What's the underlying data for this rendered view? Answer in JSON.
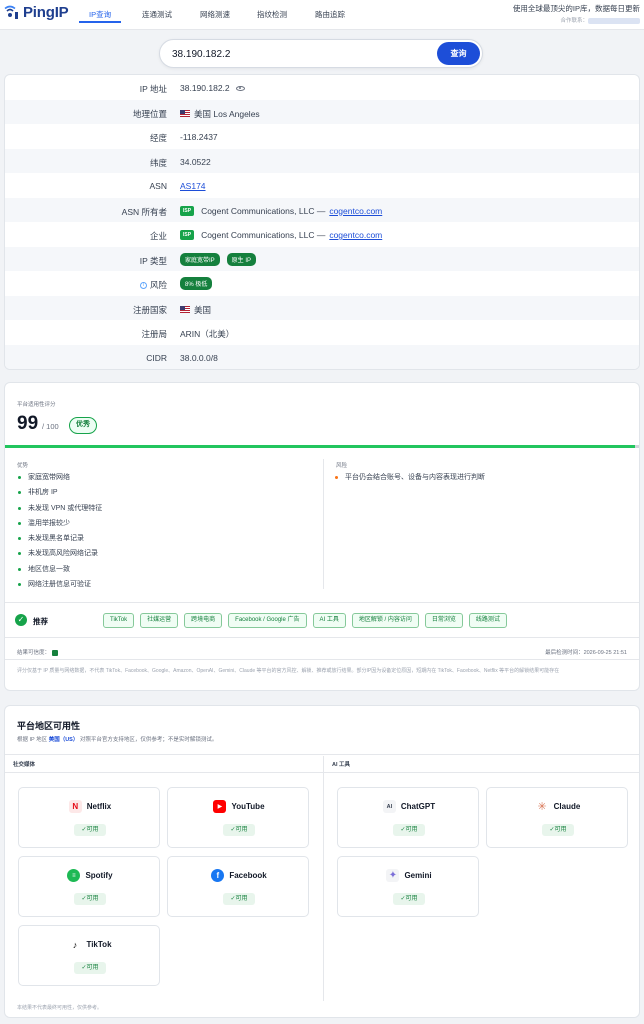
{
  "app": {
    "logo_text": "PingIP",
    "tagline": "使用全球最顶尖的IP库，数据每日更新",
    "partner_label": "合作联系："
  },
  "nav": {
    "items": [
      {
        "label": "IP查询",
        "active": true
      },
      {
        "label": "连通测试",
        "active": false
      },
      {
        "label": "网络测速",
        "active": false
      },
      {
        "label": "指纹检测",
        "active": false
      },
      {
        "label": "路由追踪",
        "active": false
      }
    ]
  },
  "search": {
    "value": "38.190.182.2",
    "button_label": "查询"
  },
  "ip_info": {
    "rows": [
      {
        "label": "IP 地址",
        "value": "38.190.182.2"
      },
      {
        "label": "地理位置",
        "value": "美国 Los Angeles"
      },
      {
        "label": "经度",
        "value": "-118.2437"
      },
      {
        "label": "纬度",
        "value": "34.0522"
      },
      {
        "label": "ASN",
        "value": "AS174"
      },
      {
        "label": "ASN 所有者",
        "value": "Cogent Communications, LLC —",
        "link": "cogentco.com",
        "badge": "ISP"
      },
      {
        "label": "企业",
        "value": "Cogent Communications, LLC —",
        "link": "cogentco.com",
        "badge": "ISP"
      },
      {
        "label": "IP 类型",
        "tags": [
          "家庭宽带IP",
          "原生 IP"
        ]
      },
      {
        "label": "风险",
        "tag": "8% 极低"
      },
      {
        "label": "注册国家",
        "value": "美国"
      },
      {
        "label": "注册局",
        "value": "ARIN（北美）"
      },
      {
        "label": "CIDR",
        "value": "38.0.0.0/8"
      }
    ]
  },
  "score": {
    "label": "平台适用性评分",
    "value": "99",
    "max": "/ 100",
    "grade": "优秀",
    "fill": 0.99,
    "advantages_label": "优势",
    "advantages": [
      "家庭宽带网络",
      "非机房 IP",
      "未发现 VPN 或代理特征",
      "滥用举报较少",
      "未发现黑名单记录",
      "未发现高风险网络记录",
      "地区信息一致",
      "网络注册信息可验证"
    ],
    "risks_label": "风险",
    "risks": [
      "平台仍会结合账号、设备与内容表现进行判断"
    ],
    "recommend_label": "推荐",
    "recommend_chips": [
      "TikTok",
      "社媒运营",
      "跨境电商",
      "Facebook / Google 广告",
      "AI 工具",
      "地区解锁 / 内容访问",
      "日常浏览",
      "线路测试"
    ],
    "accuracy_label": "结果可信度：",
    "detect_time": "最后检测时间：2026-09-25 21:51",
    "disclaimer": "评分仅基于 IP 质量与网络数据，不代表 TikTok、Facebook、Google、Amazon、OpenAI、Gemini、Claude 等平台的官方风控、解锁、推荐或放行结果。部分IP因为设备定位原因，短期内在 TikTok、Facebook、Netflix 等平台的解锁结果可能存在"
  },
  "platforms": {
    "title": "平台地区可用性",
    "subtitle_prefix": "根据 IP 地区",
    "subtitle_region": "美国（US）",
    "subtitle_suffix": "对照平台官方支持地区，仅供参考；不是实时解锁测试。",
    "social_label": "社交媒体",
    "ai_label": "AI 工具",
    "social": [
      {
        "name": "Netflix",
        "status": "✓可用",
        "icon": "netflix-icon",
        "color": "#e50914"
      },
      {
        "name": "YouTube",
        "status": "✓可用",
        "icon": "youtube-icon",
        "color": "#ff0000"
      },
      {
        "name": "Spotify",
        "status": "✓可用",
        "icon": "spotify-icon",
        "color": "#1db954"
      },
      {
        "name": "Facebook",
        "status": "✓可用",
        "icon": "facebook-icon",
        "color": "#1877f2"
      },
      {
        "name": "TikTok",
        "status": "✓可用",
        "icon": "tiktok-icon",
        "color": "#000000"
      }
    ],
    "ai": [
      {
        "name": "ChatGPT",
        "status": "✓可用",
        "icon": "chatgpt-icon",
        "color": "#374151"
      },
      {
        "name": "Claude",
        "status": "✓可用",
        "icon": "claude-icon",
        "color": "#d97757"
      },
      {
        "name": "Gemini",
        "status": "✓可用",
        "icon": "gemini-icon",
        "color": "#7c6fd8"
      }
    ],
    "footnote": "本结果不代表最终可用性，仅供参考。"
  }
}
